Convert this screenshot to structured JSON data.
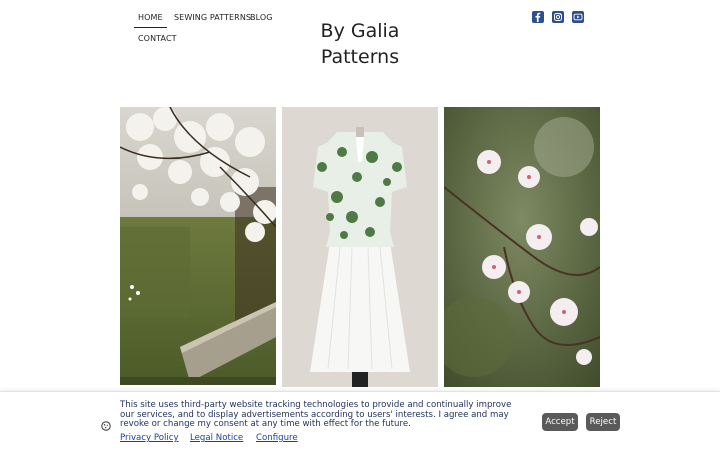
{
  "nav": {
    "items": [
      {
        "label": "HOME",
        "active": true
      },
      {
        "label": "SEWING PATTERNS",
        "active": false
      },
      {
        "label": "BLOG",
        "active": false
      },
      {
        "label": "CONTACT",
        "active": false
      }
    ]
  },
  "header": {
    "title_line1": "By Galia",
    "title_line2": "Patterns"
  },
  "social": {
    "facebook": {
      "icon": "facebook-icon",
      "color": "#2d4e8f"
    },
    "instagram": {
      "icon": "instagram-icon",
      "color": "#2d4e8f"
    },
    "youtube": {
      "icon": "youtube-icon",
      "color": "#2d4e8f"
    }
  },
  "gallery": {
    "images": [
      {
        "subject": "white blossom tree over wooden bench"
      },
      {
        "subject": "green floral blouse with white skirt on dress form"
      },
      {
        "subject": "close-up of white cherry blossoms"
      }
    ]
  },
  "cookie": {
    "message": "This site uses third-party website tracking technologies to provide and continually improve our services, and to display advertisements according to users' interests. I agree and may revoke or change my consent at any time with effect for the future.",
    "links": {
      "privacy": "Privacy Policy",
      "legal": "Legal Notice",
      "configure": "Configure"
    },
    "accept_label": "Accept",
    "reject_label": "Reject",
    "button_color": "#5a5a5a",
    "link_color": "#1f3f9a"
  }
}
